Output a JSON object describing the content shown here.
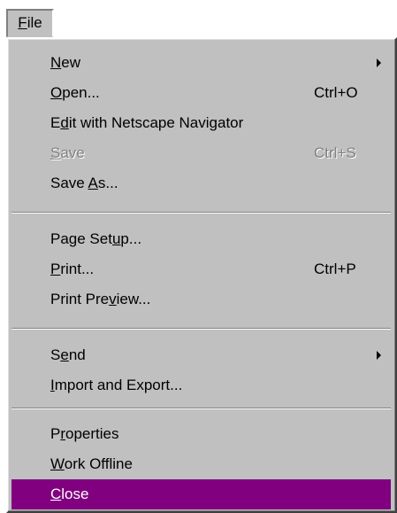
{
  "menubar": {
    "file_menu": {
      "pre": "",
      "key": "F",
      "post": "ile"
    }
  },
  "menu": {
    "items": [
      {
        "pre": "",
        "key": "N",
        "post": "ew",
        "shortcut": "",
        "submenu": true
      },
      {
        "pre": "",
        "key": "O",
        "post": "pen...",
        "shortcut": "Ctrl+O"
      },
      {
        "pre": "E",
        "key": "d",
        "post": "it with Netscape Navigator",
        "shortcut": ""
      },
      {
        "pre": "",
        "key": "S",
        "post": "ave",
        "shortcut": "Ctrl+S",
        "disabled": true
      },
      {
        "pre": "Save ",
        "key": "A",
        "post": "s...",
        "shortcut": ""
      },
      {
        "pre": "Page Set",
        "key": "u",
        "post": "p...",
        "shortcut": ""
      },
      {
        "pre": "",
        "key": "P",
        "post": "rint...",
        "shortcut": "Ctrl+P"
      },
      {
        "pre": "Print Pre",
        "key": "v",
        "post": "iew...",
        "shortcut": ""
      },
      {
        "pre": "S",
        "key": "e",
        "post": "nd",
        "shortcut": "",
        "submenu": true
      },
      {
        "pre": "",
        "key": "I",
        "post": "mport and Export...",
        "shortcut": ""
      },
      {
        "pre": "P",
        "key": "r",
        "post": "operties",
        "shortcut": ""
      },
      {
        "pre": "",
        "key": "W",
        "post": "ork Offline",
        "shortcut": ""
      },
      {
        "pre": "",
        "key": "C",
        "post": "lose",
        "shortcut": "",
        "highlighted": true
      }
    ]
  },
  "colors": {
    "menu_background": "#c0c0c0",
    "highlight": "#800080",
    "highlight_text": "#ffffff",
    "disabled_text": "#808080"
  }
}
